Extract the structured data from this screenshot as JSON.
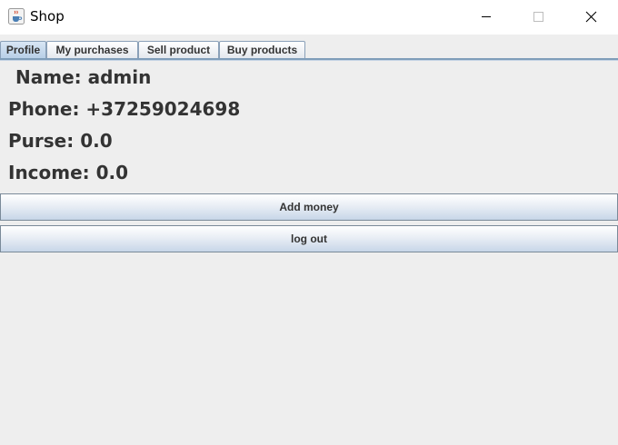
{
  "window": {
    "title": "Shop",
    "app_icon": "java-cup-icon"
  },
  "tabs": [
    {
      "label": "Profile",
      "selected": true
    },
    {
      "label": "My purchases",
      "selected": false
    },
    {
      "label": "Sell product",
      "selected": false
    },
    {
      "label": "Buy products",
      "selected": false
    }
  ],
  "profile": {
    "name": "Name: admin",
    "phone": "Phone: +37259024698",
    "purse": "Purse: 0.0",
    "income": "Income: 0.0"
  },
  "buttons": {
    "add_money": "Add money",
    "log_out": "log out"
  },
  "colors": {
    "tab_selected": "#b8cfe7",
    "tab_border": "#7f9db9",
    "background": "#eeeeee"
  }
}
